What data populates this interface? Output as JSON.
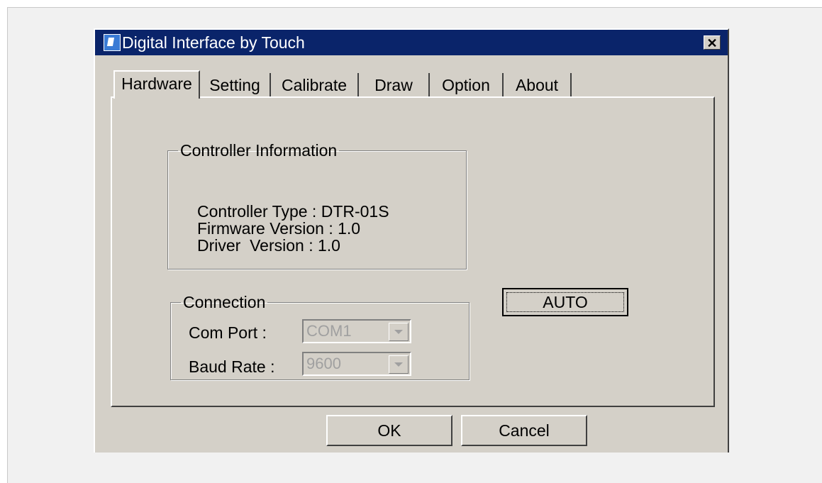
{
  "window": {
    "title": "Digital Interface by Touch",
    "close_glyph": "✕",
    "title_bar_color": "#0a246a",
    "face_color": "#d4d0c8"
  },
  "tabs": [
    {
      "label": "Hardware",
      "active": true
    },
    {
      "label": "Setting",
      "active": false
    },
    {
      "label": "Calibrate",
      "active": false
    },
    {
      "label": "Draw",
      "active": false
    },
    {
      "label": "Option",
      "active": false
    },
    {
      "label": "About",
      "active": false
    }
  ],
  "controller_info": {
    "legend": "Controller Information",
    "controller_type": "Controller Type : DTR-01S",
    "firmware_version": "Firmware Version : 1.0",
    "driver_version": "Driver  Version : 1.0"
  },
  "connection": {
    "legend": "Connection",
    "com_port_label": "Com Port   :",
    "com_port_value": "COM1",
    "baud_rate_label": "Baud Rate :",
    "baud_rate_value": "9600"
  },
  "buttons": {
    "auto": "AUTO",
    "ok": "OK",
    "cancel": "Cancel"
  }
}
